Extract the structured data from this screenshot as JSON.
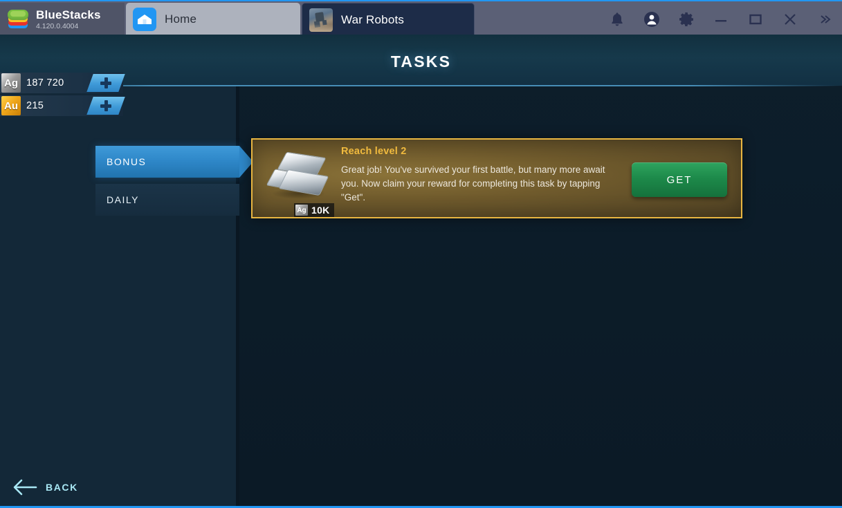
{
  "titlebar": {
    "brand_name": "BlueStacks",
    "brand_version": "4.120.0.4004",
    "tabs": [
      {
        "label": "Home",
        "icon": "home-icon",
        "active": false
      },
      {
        "label": "War Robots",
        "icon": "game-thumbnail-icon",
        "active": true
      }
    ],
    "window_buttons": [
      {
        "name": "notifications-icon",
        "glyph": "bell"
      },
      {
        "name": "account-icon",
        "glyph": "user"
      },
      {
        "name": "settings-icon",
        "glyph": "gear"
      },
      {
        "name": "minimize-button",
        "glyph": "minimize"
      },
      {
        "name": "maximize-button",
        "glyph": "maximize"
      },
      {
        "name": "close-button",
        "glyph": "close"
      },
      {
        "name": "more-button",
        "glyph": "chevrons-right"
      }
    ]
  },
  "game": {
    "screen_title": "TASKS",
    "currencies": [
      {
        "symbol": "Ag",
        "name": "silver",
        "value": "187 720",
        "add_label": "+",
        "color": "#9b9b9b"
      },
      {
        "symbol": "Au",
        "name": "gold",
        "value": "215",
        "add_label": "+",
        "color": "#f0a81c"
      }
    ],
    "category_tabs": [
      {
        "label": "BONUS",
        "active": true
      },
      {
        "label": "DAILY",
        "active": false
      }
    ],
    "task": {
      "title": "Reach level 2",
      "description": "Great job! You've survived your first battle, but many more await you. Now claim your reward for completing this task by tapping \"Get\".",
      "reward_symbol": "Ag",
      "reward_amount": "10K",
      "reward_icon": "silver-ingots-icon",
      "action_label": "GET"
    },
    "back_label": "BACK",
    "accent_colors": {
      "card_border": "#e9b641",
      "get_button": "#1d8a4a",
      "active_tab": "#2e87c8",
      "title_glow": "#78c8ff",
      "back_text": "#a9e8f5"
    }
  }
}
